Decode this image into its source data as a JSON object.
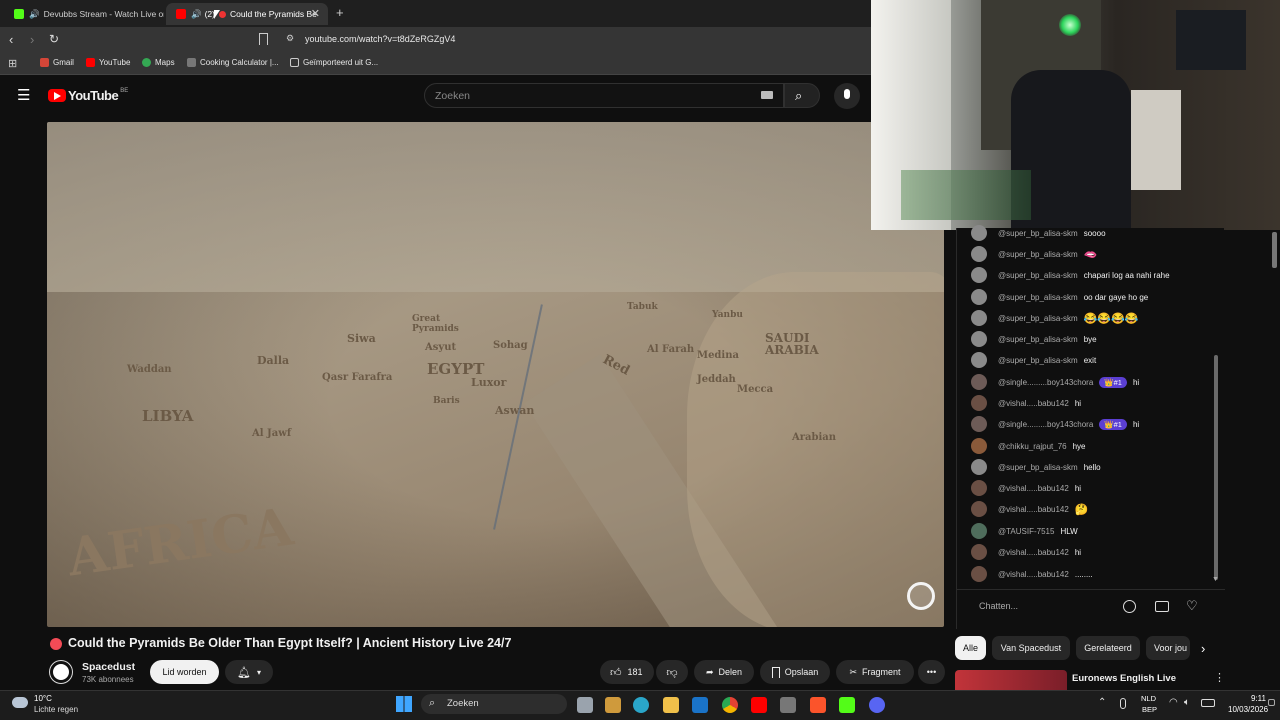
{
  "browser": {
    "tabs": [
      {
        "title": "Devubbs Stream - Watch Live on"
      },
      {
        "badge": "(2)",
        "title": "Could the Pyramids Be"
      }
    ],
    "new_tab": "+",
    "url": "youtube.com/watch?v=t8dZeRGZgV4",
    "bookmarks": [
      "Gmail",
      "YouTube",
      "Maps",
      "Cooking Calculator |...",
      "Geïmporteerd uit G..."
    ]
  },
  "youtube": {
    "logo": "YouTube",
    "region": "BE",
    "search_placeholder": "Zoeken"
  },
  "video": {
    "map_labels": [
      "Siwa",
      "Great Pyramids",
      "Asyut",
      "Sohag",
      "EGYPT",
      "Qasr Farafra",
      "Luxor",
      "Baris",
      "Aswan",
      "Dalla",
      "Waddan",
      "LIBYA",
      "Al Jawf",
      "AFRICA",
      "Red",
      "Al Farah",
      "Medina",
      "Jeddah",
      "Mecca",
      "SAUDI ARABIA",
      "Arabian",
      "Tabuk",
      "Yanbu"
    ],
    "title": "Could the Pyramids Be Older Than Egypt Itself? | Ancient History Live 24/7"
  },
  "channel": {
    "name": "Spacedust",
    "subscribers": "73K abonnees",
    "join_label": "Lid worden"
  },
  "actions": {
    "likes": "181",
    "share": "Delen",
    "save": "Opslaan",
    "clip": "Fragment"
  },
  "chat": {
    "messages": [
      {
        "author": "@super_bp_alisa-skm",
        "text": "soooo"
      },
      {
        "author": "@super_bp_alisa-skm",
        "text": "",
        "emoji": "🫦"
      },
      {
        "author": "@super_bp_alisa-skm",
        "text": "chapari log aa nahi rahe"
      },
      {
        "author": "@super_bp_alisa-skm",
        "text": "oo dar gaye ho ge"
      },
      {
        "author": "@super_bp_alisa-skm",
        "text": "😂😂😂😂"
      },
      {
        "author": "@super_bp_alisa-skm",
        "text": "bye"
      },
      {
        "author": "@super_bp_alisa-skm",
        "text": "exit"
      },
      {
        "author": "@single.........boy143chora",
        "badge": "👑#1",
        "text": "hi"
      },
      {
        "author": "@vishal.....babu142",
        "text": "hi"
      },
      {
        "author": "@single.........boy143chora",
        "badge": "👑#1",
        "text": "hi"
      },
      {
        "author": "@chikku_rajput_76",
        "text": "hye"
      },
      {
        "author": "@super_bp_alisa-skm",
        "text": "hello"
      },
      {
        "author": "@vishal.....babu142",
        "text": "hi"
      },
      {
        "author": "@vishal.....babu142",
        "text": "🤔"
      },
      {
        "author": "@TAUSIF-7515",
        "text": "HLW"
      },
      {
        "author": "@vishal.....babu142",
        "text": "hi"
      },
      {
        "author": "@vishal.....babu142",
        "text": "........"
      }
    ],
    "input_placeholder": "Chatten..."
  },
  "chips": [
    "Alle",
    "Van Spacedust",
    "Gerelateerd",
    "Voor jou"
  ],
  "recommended": {
    "title": "Euronews English Live"
  },
  "taskbar": {
    "temperature": "10°C",
    "weather": "Lichte regen",
    "search": "Zoeken",
    "language": "NLD",
    "layout": "BEP",
    "time": "9:11",
    "date": "10/03/2026"
  }
}
